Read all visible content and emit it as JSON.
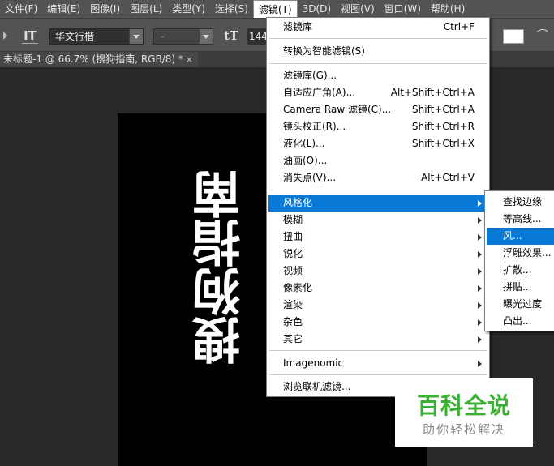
{
  "menubar": {
    "items": [
      "文件(F)",
      "编辑(E)",
      "图像(I)",
      "图层(L)",
      "类型(Y)",
      "选择(S)",
      "滤镜(T)",
      "3D(D)",
      "视图(V)",
      "窗口(W)",
      "帮助(H)"
    ]
  },
  "options": {
    "font_family": "华文行楷",
    "font_style": "-",
    "font_size": "144"
  },
  "document_tab": {
    "title": "未标题-1 @ 66.7% (搜狗指南, RGB/8) *",
    "close": "×"
  },
  "canvas": {
    "text": "搜狗指南"
  },
  "filter_menu": {
    "items": [
      {
        "label": "滤镜库",
        "shortcut": "Ctrl+F"
      },
      {
        "label": "转换为智能滤镜(S)",
        "shortcut": ""
      },
      {
        "label": "滤镜库(G)...",
        "shortcut": ""
      },
      {
        "label": "自适应广角(A)...",
        "shortcut": "Alt+Shift+Ctrl+A"
      },
      {
        "label": "Camera Raw 滤镜(C)...",
        "shortcut": "Shift+Ctrl+A"
      },
      {
        "label": "镜头校正(R)...",
        "shortcut": "Shift+Ctrl+R"
      },
      {
        "label": "液化(L)...",
        "shortcut": "Shift+Ctrl+X"
      },
      {
        "label": "油画(O)...",
        "shortcut": ""
      },
      {
        "label": "消失点(V)...",
        "shortcut": "Alt+Ctrl+V"
      },
      {
        "label": "风格化",
        "shortcut": ""
      },
      {
        "label": "模糊",
        "shortcut": ""
      },
      {
        "label": "扭曲",
        "shortcut": ""
      },
      {
        "label": "锐化",
        "shortcut": ""
      },
      {
        "label": "视频",
        "shortcut": ""
      },
      {
        "label": "像素化",
        "shortcut": ""
      },
      {
        "label": "渲染",
        "shortcut": ""
      },
      {
        "label": "杂色",
        "shortcut": ""
      },
      {
        "label": "其它",
        "shortcut": ""
      },
      {
        "label": "Imagenomic",
        "shortcut": ""
      },
      {
        "label": "浏览联机滤镜...",
        "shortcut": ""
      }
    ]
  },
  "stylize_submenu": {
    "items": [
      "查找边缘",
      "等高线...",
      "风...",
      "浮雕效果...",
      "扩散...",
      "拼贴...",
      "曝光过度",
      "凸出..."
    ]
  },
  "watermark": {
    "title": "百科全说",
    "subtitle": "助你轻松解决"
  }
}
